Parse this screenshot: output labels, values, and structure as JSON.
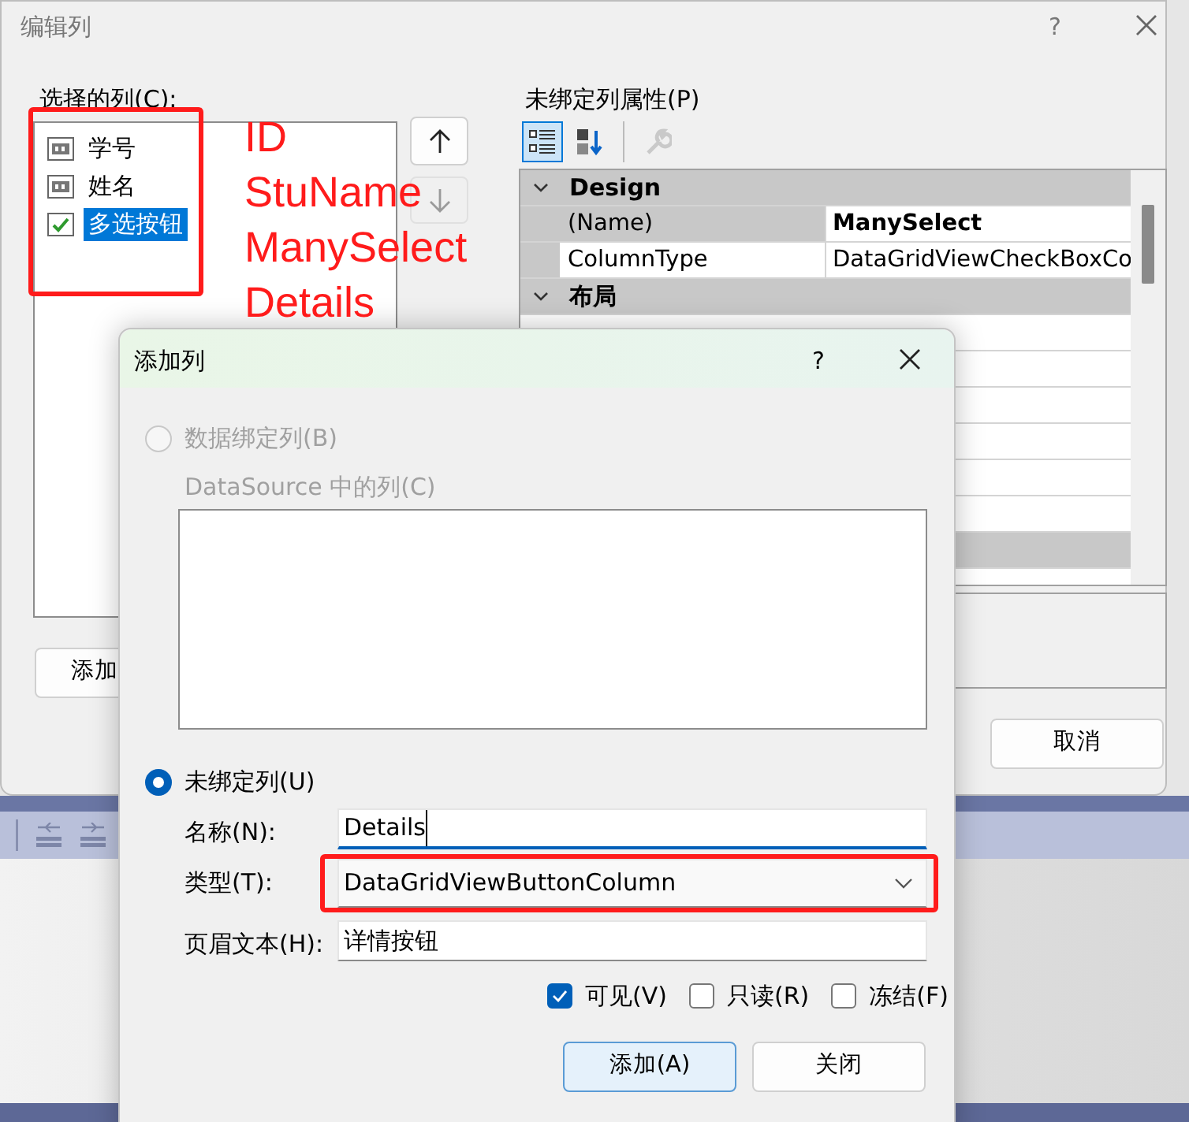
{
  "editor_window": {
    "title": "编辑列",
    "help": "?",
    "columns_label": "选择的列(C):",
    "columns": {
      "highlighted": true,
      "items": [
        {
          "label": "学号",
          "kind": "text",
          "selected": false
        },
        {
          "label": "姓名",
          "kind": "text",
          "selected": false
        },
        {
          "label": "多选按钮",
          "kind": "checkbox",
          "selected": true
        }
      ]
    },
    "annotation": [
      "ID",
      "StuName",
      "ManySelect",
      "Details"
    ],
    "move_buttons": [
      {
        "kind": "up",
        "disabled": false
      },
      {
        "kind": "down",
        "disabled": true
      }
    ],
    "properties_label": "未绑定列属性(P)",
    "toolbar": [
      {
        "kind": "categorized",
        "selected": true,
        "disabled": false
      },
      {
        "kind": "alphabetical",
        "selected": false,
        "disabled": false
      },
      {
        "kind": "property_pages",
        "selected": false,
        "disabled": true
      }
    ],
    "categories": [
      {
        "name": "Design",
        "expanded": true,
        "rows": [
          {
            "name": "(Name)",
            "value": "ManySelect",
            "selected": true,
            "bold": true
          },
          {
            "name": "ColumnType",
            "value": "DataGridViewCheckBoxCo",
            "selected": false,
            "bold": false
          }
        ]
      },
      {
        "name": "布局",
        "expanded": true
      }
    ],
    "add_button": "添加",
    "cancel_button": "取消"
  },
  "add_dialog": {
    "title": "添加列",
    "help": "?",
    "bound_option": {
      "label": "数据绑定列(B)",
      "selected": false,
      "disabled": true
    },
    "datasource_label": "DataSource 中的列(C)",
    "unbound_option": {
      "label": "未绑定列(U)",
      "selected": true,
      "disabled": false
    },
    "fields": [
      {
        "label": "名称(N):",
        "value": "Details",
        "kind": "text",
        "focused": true,
        "highlighted": false
      },
      {
        "label": "类型(T):",
        "value": "DataGridViewButtonColumn",
        "kind": "dropdown",
        "focused": false,
        "highlighted": true
      },
      {
        "label": "页眉文本(H):",
        "value": "详情按钮",
        "kind": "text",
        "focused": false,
        "highlighted": false
      }
    ],
    "checkboxes": [
      {
        "label": "可见(V)",
        "checked": true
      },
      {
        "label": "只读(R)",
        "checked": false
      },
      {
        "label": "冻结(F)",
        "checked": false
      }
    ],
    "buttons": [
      {
        "label": "添加(A)",
        "default": true
      },
      {
        "label": "关闭",
        "default": false
      }
    ]
  }
}
